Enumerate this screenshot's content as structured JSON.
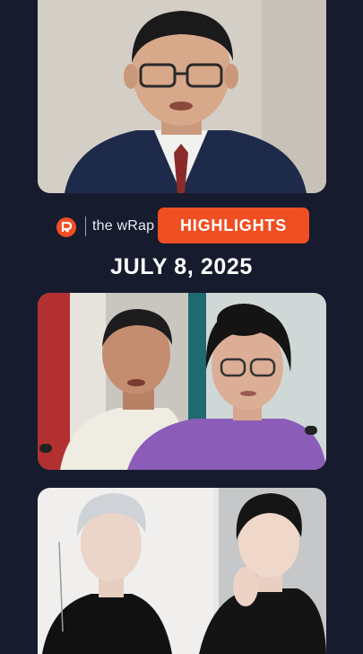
{
  "header": {
    "brand_label": "the wRap",
    "badge_label": "HIGHLIGHTS",
    "date": "JULY 8, 2025"
  },
  "colors": {
    "background": "#171b2e",
    "accent": "#f04e23",
    "text": "#ffffff"
  },
  "icons": [
    "rappler-logo-icon"
  ],
  "photos": [
    {
      "subject": "man in suit with glasses speaking"
    },
    {
      "subject": "man and woman at podiums"
    },
    {
      "subject": "two young performers posing"
    }
  ]
}
